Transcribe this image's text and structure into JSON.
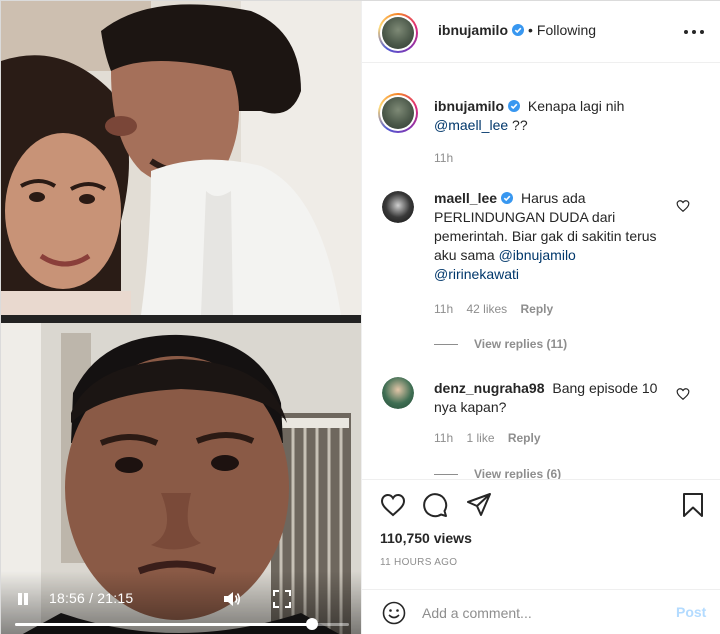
{
  "header": {
    "username": "ibnujamilo",
    "follow_status": "Following",
    "dot": "•"
  },
  "caption": {
    "username": "ibnujamilo",
    "text": "Kenapa lagi nih",
    "mention": "@maell_lee",
    "suffix": " ??",
    "time": "11h"
  },
  "comments": [
    {
      "username": "maell_lee",
      "text": "Harus ada PERLINDUNGAN DUDA dari pemerintah. Biar gak di sakitin terus aku sama",
      "mention1": "@ibnujamilo",
      "mention2": "@ririnekawati",
      "time": "11h",
      "likes": "42 likes",
      "reply": "Reply",
      "view_replies": "View replies (11)"
    },
    {
      "username": "denz_nugraha98",
      "text": "Bang episode 10 nya kapan?",
      "time": "11h",
      "likes": "1 like",
      "reply": "Reply",
      "view_replies": "View replies (6)"
    }
  ],
  "post_info": {
    "views": "110,750 views",
    "time_ago": "11 HOURS AGO"
  },
  "comment_box": {
    "placeholder": "Add a comment...",
    "post_label": "Post"
  },
  "video": {
    "current_time": "18:56",
    "duration": "21:15",
    "time_display": "18:56 / 21:15",
    "progress": 0.89
  },
  "icons": {
    "verified": "verified-badge-icon",
    "more": "more-options-icon",
    "like": "heart-icon",
    "comment": "comment-icon",
    "share": "share-icon",
    "save": "bookmark-icon",
    "emoji": "emoji-icon",
    "pause": "pause-icon",
    "volume": "volume-icon",
    "fullscreen": "fullscreen-icon"
  },
  "colors": {
    "verified": "#3897f0",
    "mention": "#00376b",
    "meta": "#8e8e8e",
    "post_disabled": "#b3dbff"
  }
}
